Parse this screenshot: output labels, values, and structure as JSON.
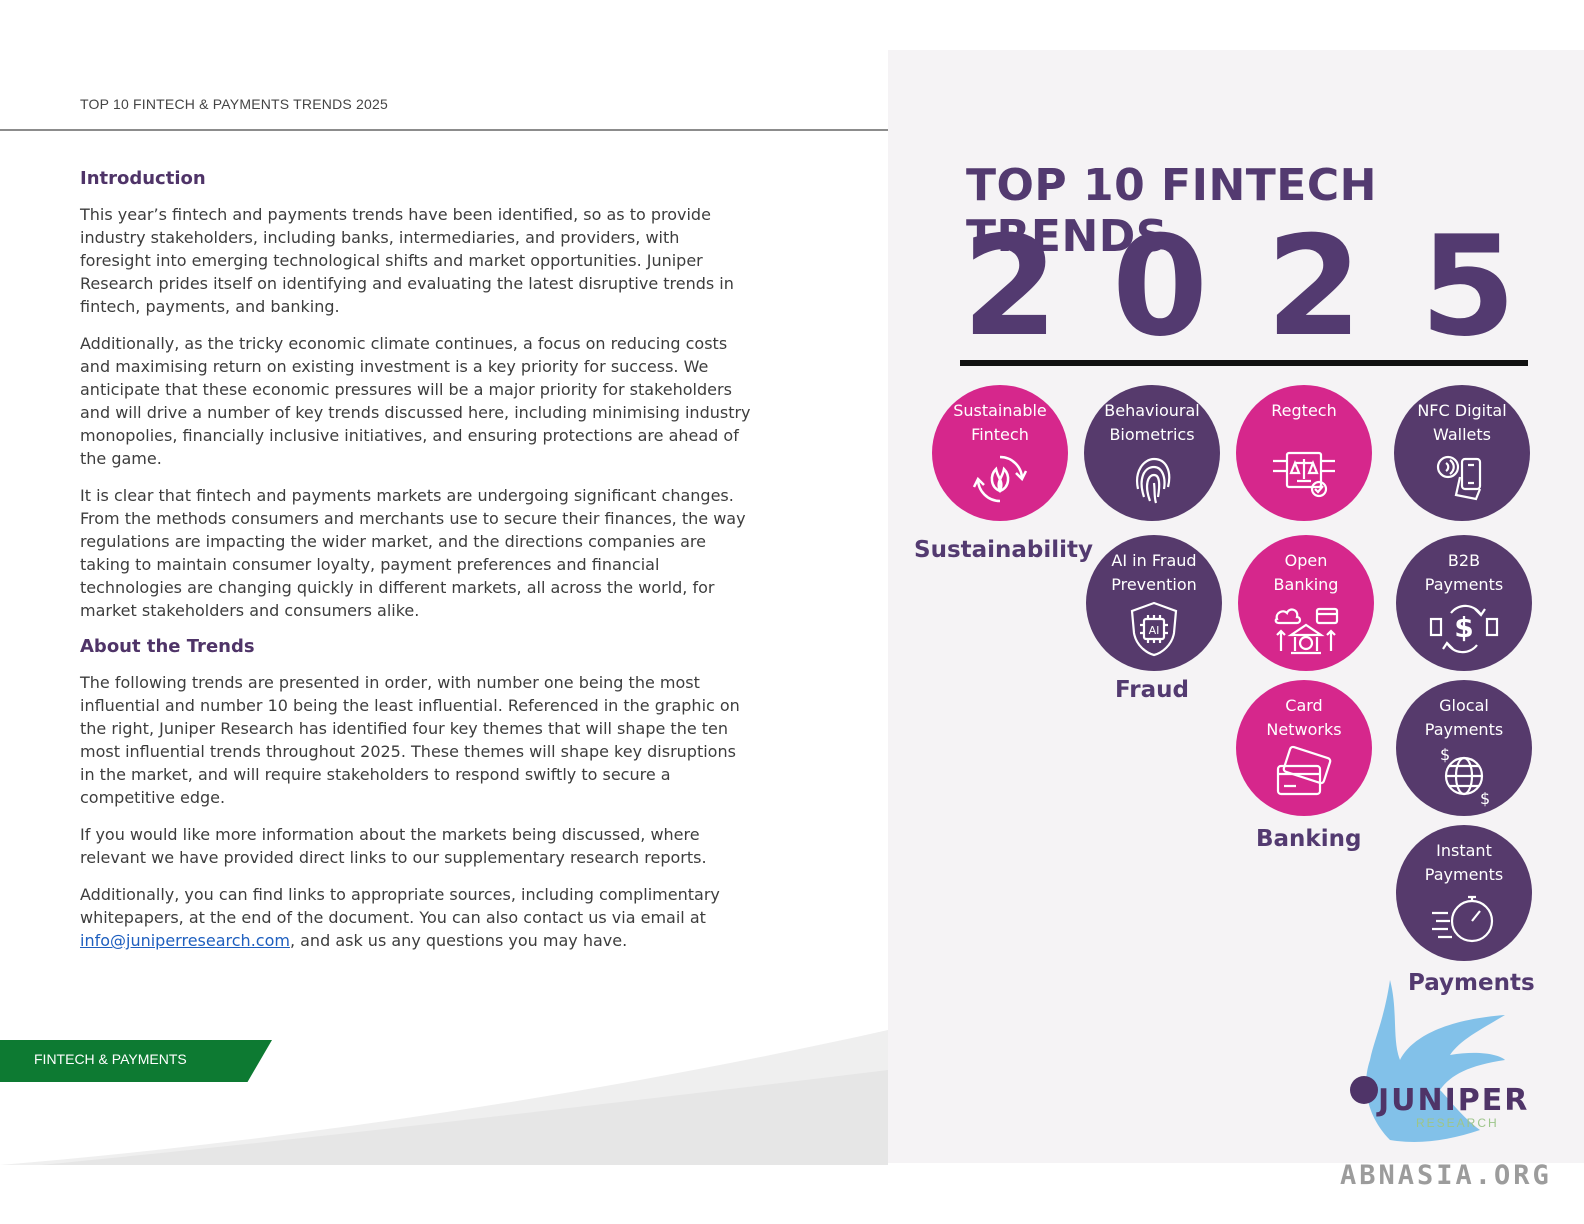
{
  "header": {
    "title": "TOP 10 FINTECH & PAYMENTS TRENDS 2025"
  },
  "intro": {
    "heading": "Introduction",
    "p1": "This year’s fintech and payments trends have been identified, so as to provide industry stakeholders, including banks, intermediaries, and providers, with foresight into emerging technological shifts and market opportunities. Juniper Research prides itself on identifying and evaluating the latest disruptive trends in fintech, payments, and banking.",
    "p2": "Additionally, as the tricky economic climate continues, a focus on reducing costs and maximising return on existing investment is a key priority for success. We anticipate that these economic pressures will be a major priority for stakeholders and will drive a number of key trends discussed here, including minimising industry monopolies, financially inclusive initiatives, and ensuring protections are ahead of the game.",
    "p3": "It is clear that fintech and payments markets are undergoing significant changes. From the methods consumers and merchants use to secure their finances, the way regulations are impacting the wider market, and the directions companies are taking to maintain consumer loyalty, payment preferences and financial technologies are changing quickly in different markets, all across the world, for market stakeholders and consumers alike."
  },
  "about": {
    "heading": "About the Trends",
    "p1": "The following trends are presented in order, with number one being the most influential and number 10 being the least influential. Referenced in the graphic on the right, Juniper Research has identified four key themes that will shape the ten most influential trends throughout 2025. These themes will shape key disruptions in the market, and will require stakeholders to respond swiftly to secure a competitive edge.",
    "p2": "If you would like more information about the markets being discussed, where relevant we have provided direct links to our supplementary research reports.",
    "p3_start": "Additionally, you can find links to appropriate sources, including complimentary whitepapers, at the end of the document. You can also contact us via email at",
    "email": "info@juniperresearch.com",
    "p3_end": ", and ask us any questions you may have."
  },
  "footer_tab": "FINTECH & PAYMENTS",
  "graphic": {
    "title": "TOP 10 FINTECH TRENDS",
    "year_digits": [
      "2",
      "0",
      "2",
      "5"
    ],
    "trends": [
      {
        "line1": "Sustainable",
        "line2": "Fintech",
        "icon": "leaf-recycle-icon",
        "color": "#d6278c"
      },
      {
        "line1": "Behavioural",
        "line2": "Biometrics",
        "icon": "fingerprint-icon",
        "color": "#563a6c"
      },
      {
        "line1": "Regtech",
        "line2": "",
        "icon": "regulation-scale-icon",
        "color": "#d6278c"
      },
      {
        "line1": "NFC Digital",
        "line2": "Wallets",
        "icon": "nfc-phone-icon",
        "color": "#563a6c"
      },
      {
        "line1": "AI in Fraud",
        "line2": "Prevention",
        "icon": "ai-shield-icon",
        "color": "#563a6c"
      },
      {
        "line1": "Open",
        "line2": "Banking",
        "icon": "open-banking-icon",
        "color": "#d6278c"
      },
      {
        "line1": "B2B",
        "line2": "Payments",
        "icon": "b2b-dollar-icon",
        "color": "#563a6c"
      },
      {
        "line1": "Card",
        "line2": "Networks",
        "icon": "cards-icon",
        "color": "#d6278c"
      },
      {
        "line1": "Glocal",
        "line2": "Payments",
        "icon": "globe-dollar-icon",
        "color": "#563a6c"
      },
      {
        "line1": "Instant",
        "line2": "Payments",
        "icon": "stopwatch-icon",
        "color": "#563a6c"
      }
    ],
    "themes": [
      "Sustainability",
      "Fraud",
      "Banking",
      "Payments"
    ]
  },
  "logo": {
    "name": "JUNIPER",
    "sub": "RESEARCH"
  },
  "watermark": "ABNASIA.ORG"
}
